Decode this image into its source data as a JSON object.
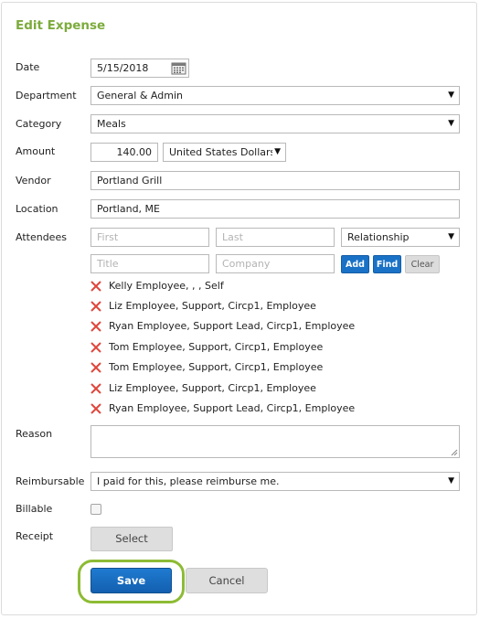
{
  "form": {
    "title": "Edit Expense"
  },
  "labels": {
    "date": "Date",
    "department": "Department",
    "category": "Category",
    "amount": "Amount",
    "vendor": "Vendor",
    "location": "Location",
    "attendees": "Attendees",
    "reason": "Reason",
    "reimbursable": "Reimbursable",
    "billable": "Billable",
    "receipt": "Receipt"
  },
  "fields": {
    "date_value": "5/15/2018",
    "department_value": "General & Admin",
    "category_value": "Meals",
    "amount_value": "140.00",
    "currency_value": "United States Dollars",
    "vendor_value": "Portland Grill",
    "location_value": "Portland, ME",
    "reason_value": "",
    "reimbursable_value": "I paid for this, please reimburse me.",
    "billable_checked": false
  },
  "attendee_form": {
    "first_placeholder": "First",
    "last_placeholder": "Last",
    "relationship_value": "Relationship",
    "title_placeholder": "Title",
    "company_placeholder": "Company",
    "add_label": "Add",
    "find_label": "Find",
    "clear_label": "Clear"
  },
  "attendees": [
    "Kelly Employee, , , Self",
    "Liz Employee, Support, Circp1, Employee",
    "Ryan Employee, Support Lead, Circp1, Employee",
    "Tom Employee, Support, Circp1, Employee",
    "Tom Employee, Support, Circp1, Employee",
    "Liz Employee, Support, Circp1, Employee",
    "Ryan Employee, Support Lead, Circp1, Employee"
  ],
  "buttons": {
    "select_label": "Select",
    "save_label": "Save",
    "cancel_label": "Cancel"
  },
  "colors": {
    "title_green": "#7cab3c",
    "primary_blue": "#1a72c6",
    "remove_red": "#e0463c",
    "highlight_ring": "#8dbb34"
  }
}
